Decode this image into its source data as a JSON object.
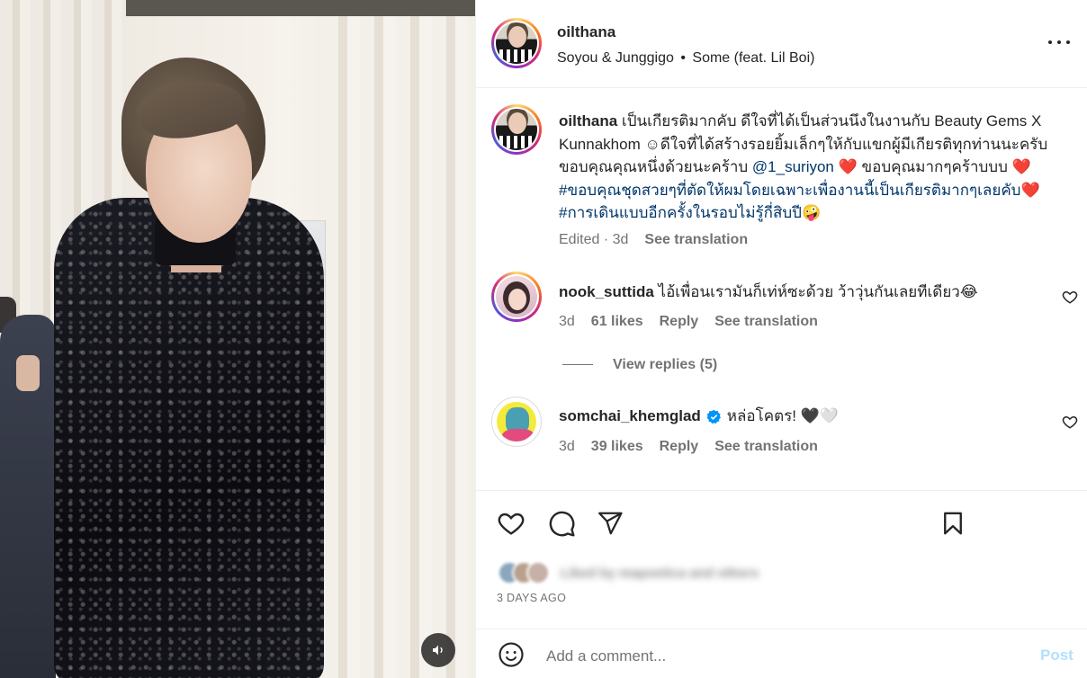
{
  "post": {
    "username": "oilthana",
    "music_artist": "Soyou & Junggigo",
    "music_separator": "•",
    "music_track": "Some (feat. Lil Boi)"
  },
  "caption": {
    "username": "oilthana",
    "text_1": "เป็นเกียรติมากคับ ดีใจที่ได้เป็นส่วนนึงในงานกับ Beauty Gems X Kunnakhom ☺︎ดีใจที่ได้สร้างรอยยิ้มเล็กๆให้กับแขกผู้มีเกียรติทุกท่านนะครับ ขอบคุณคุณหนึ่งด้วยนะคร้าบ ",
    "mention": "@1_suriyon",
    "heart_1": "❤️",
    "text_2": " ขอบคุณมากๆคร้าบบบ ",
    "heart_2": "❤️",
    "hashtag_1": "#ขอบคุณชุดสวยๆที่ตัดให้ผมโดยเฉพาะเพื่องานนี้เป็นเกียรติมากๆเลยคับ",
    "heart_3": "❤️",
    "hashtag_2": "#การเดินแบบอีกครั้งในรอบไม่รู้กี่สิบปี",
    "emoji_end": "🤪",
    "edited": "Edited · 3d",
    "see_translation": "See translation"
  },
  "comments": [
    {
      "username": "nook_suttida",
      "text": "ไอ้เพื่อนเรามันก็เท่ห์ซะด้วย ว้าวุ่นกันเลยทีเดียว😂",
      "age": "3d",
      "likes": "61 likes",
      "reply": "Reply",
      "see_translation": "See translation",
      "view_replies": "View replies (5)"
    },
    {
      "username": "somchai_khemglad",
      "verified": true,
      "text": "หล่อโคตร! 🖤🤍",
      "age": "3d",
      "likes": "39 likes",
      "reply": "Reply",
      "see_translation": "See translation"
    }
  ],
  "actions": {
    "like_icon": "heart-outline-icon",
    "comment_icon": "comment-bubble-icon",
    "share_icon": "paper-plane-icon",
    "save_icon": "bookmark-icon",
    "likes_text": "Liked by mapoetica and others",
    "date": "3 DAYS AGO"
  },
  "comment_bar": {
    "emoji_icon": "smiley-icon",
    "placeholder": "Add a comment...",
    "post_label": "Post"
  },
  "colors": {
    "link": "#00376b",
    "muted": "#737373",
    "verified": "#0095f6",
    "post_disabled": "#b2dffc"
  }
}
